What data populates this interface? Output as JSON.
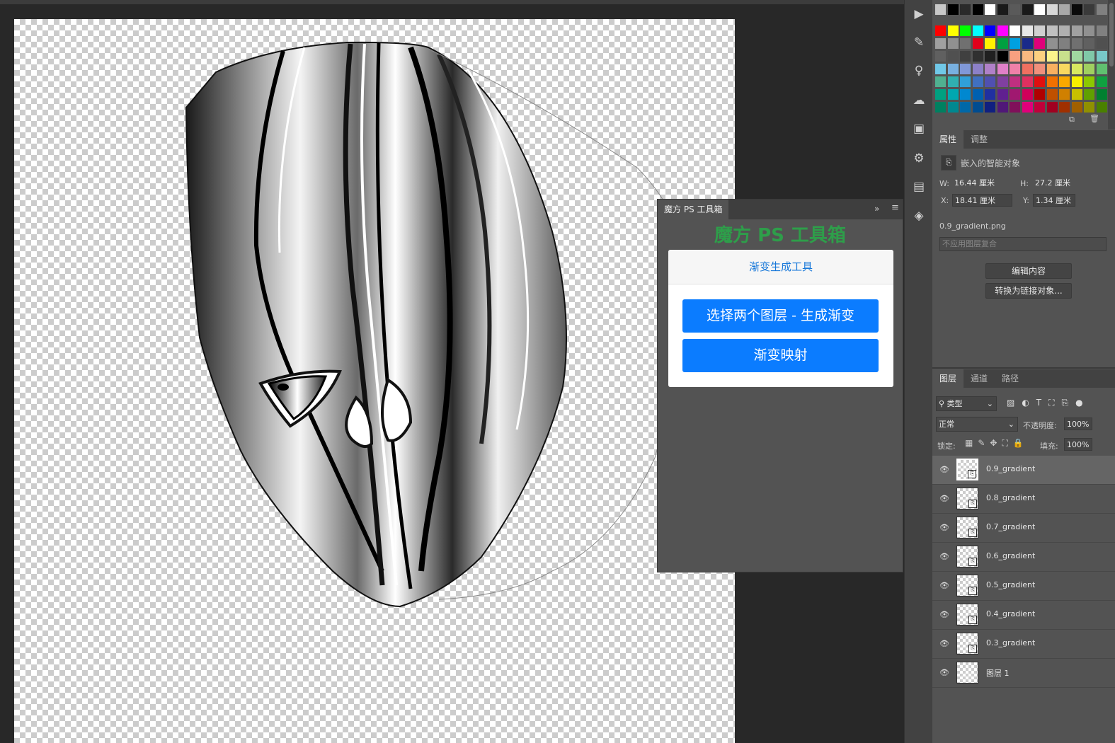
{
  "plugin": {
    "tab": "魔方 PS 工具箱",
    "expand": "»",
    "menu": "≡",
    "title": "魔方 PS 工具箱",
    "card_header": "渐变生成工具",
    "btn_generate": "选择两个图层 - 生成渐变",
    "btn_map": "渐变映射"
  },
  "properties": {
    "tab_properties": "属性",
    "tab_adjust": "调整",
    "object_type": "嵌入的智能对象",
    "w_label": "W:",
    "w_value": "16.44 厘米",
    "h_label": "H:",
    "h_value": "27.2 厘米",
    "x_label": "X:",
    "x_value": "18.41 厘米",
    "y_label": "Y:",
    "y_value": "1.34 厘米",
    "filename": "0.9_gradient.png",
    "comp_placeholder": "不应用图层复合",
    "edit_contents": "编辑内容",
    "convert_linked": "转换为链接对象..."
  },
  "layers_panel": {
    "tab_layers": "图层",
    "tab_channels": "通道",
    "tab_paths": "路径",
    "filter_kind": "类型",
    "blend_mode": "正常",
    "opacity_label": "不透明度:",
    "opacity_value": "100%",
    "lock_label": "锁定:",
    "fill_label": "填充:",
    "fill_value": "100%",
    "layers": [
      {
        "name": "0.9_gradient",
        "selected": true
      },
      {
        "name": "0.8_gradient"
      },
      {
        "name": "0.7_gradient"
      },
      {
        "name": "0.6_gradient"
      },
      {
        "name": "0.5_gradient"
      },
      {
        "name": "0.4_gradient"
      },
      {
        "name": "0.3_gradient"
      },
      {
        "name": "图层 1"
      }
    ]
  },
  "swatches": {
    "row0": [
      "#c8c8c8",
      "#000000",
      "#2a2a2a",
      "#000000",
      "#ffffff",
      "#1a1a1a",
      "#5a5a5a",
      "#1a1a1a",
      "#ffffff",
      "#d8d8d8",
      "#a8a8a8",
      "#0a0a0a",
      "#3a3a3a",
      "#808080"
    ],
    "row1": [
      "#ff0000",
      "#ffff00",
      "#00ff00",
      "#00ffff",
      "#0000ff",
      "#ff00ff",
      "#ffffff",
      "#e8e8e8",
      "#d0d0d0",
      "#c0c0c0",
      "#b0b0b0",
      "#a0a0a0",
      "#909090",
      "#808080"
    ],
    "row2": [
      "#a0a0a0",
      "#909090",
      "#707070",
      "#e0001b",
      "#fff100",
      "#00a040",
      "#00a0e0",
      "#1a2a8a",
      "#e0007a",
      "#909090",
      "#808080",
      "#707070",
      "#606060",
      "#505050"
    ],
    "row3": [
      "#606060",
      "#505050",
      "#404040",
      "#303030",
      "#202020",
      "#000000",
      "#f8a080",
      "#f8b880",
      "#fcd080",
      "#fcf48c",
      "#c8e08c",
      "#a0d8a0",
      "#80c8a8",
      "#78c8c8"
    ],
    "row4": [
      "#70c8e8",
      "#78b0e0",
      "#8098d8",
      "#8c80c8",
      "#b080c8",
      "#e080c8",
      "#f080a8",
      "#f07060",
      "#f0907c",
      "#f8b060",
      "#f8d860",
      "#d8e860",
      "#a0d060",
      "#60c070"
    ],
    "row5": [
      "#50b090",
      "#30b0b0",
      "#30a0d8",
      "#4070c0",
      "#5050b0",
      "#8040a0",
      "#c03080",
      "#e03060",
      "#e01010",
      "#f07000",
      "#f8a800",
      "#f8f000",
      "#8cc800",
      "#10a040"
    ],
    "row6": [
      "#00a080",
      "#00a8b0",
      "#0088d0",
      "#0060b0",
      "#2030a0",
      "#602090",
      "#a01870",
      "#d0005a",
      "#b00000",
      "#c05000",
      "#d08000",
      "#c8c000",
      "#60a000",
      "#008030"
    ],
    "row7": [
      "#008060",
      "#008890",
      "#0068a8",
      "#004c90",
      "#102080",
      "#501878",
      "#80105a",
      "#e0007a",
      "#c0003a",
      "#a00020",
      "#a03000",
      "#a06000",
      "#909000",
      "#4a8000"
    ]
  }
}
